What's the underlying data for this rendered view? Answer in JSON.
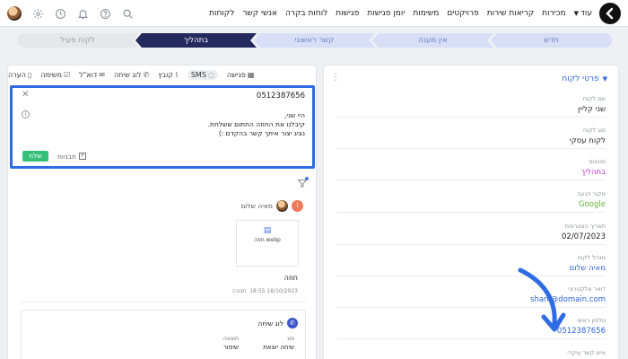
{
  "nav": {
    "items": [
      "לקוחות",
      "אנשי קשר",
      "לוחות בקרה",
      "פגישות",
      "יומן פגישות",
      "משימות",
      "פרויקטים",
      "קריאות שירות",
      "מכירות",
      "עוד"
    ]
  },
  "pipeline": {
    "stages": [
      "חדש",
      "אין מענה",
      "קשר ראשוני",
      "בתהליך",
      "לקוח פעיל"
    ],
    "active_index": 3
  },
  "details": {
    "title": "פרטי לקוח",
    "fields": [
      {
        "label": "שם לקוח",
        "value": "שני קליין",
        "style": ""
      },
      {
        "label": "סוג לקוח",
        "value": "לקוח עסקי",
        "style": ""
      },
      {
        "label": "סטטוס",
        "value": "בתהליך",
        "style": "purple"
      },
      {
        "label": "מקור הגעה",
        "value": "Google",
        "style": "green"
      },
      {
        "label": "תאריך הצטרפות",
        "value": "02/07/2023",
        "style": ""
      },
      {
        "label": "מנהל לקוח",
        "value": "מאיה שלום",
        "style": "blue"
      },
      {
        "label": "דואר אלקטרוני",
        "value": "shani@domain.com",
        "style": "blue"
      },
      {
        "label": "טלפון ראשי",
        "value": "0512387656",
        "style": "blue"
      },
      {
        "label": "איש קשר עיקרי",
        "value": "",
        "style": ""
      }
    ]
  },
  "activity": {
    "tabs": [
      {
        "label": "הערה",
        "icon": "note-icon"
      },
      {
        "label": "משימה",
        "icon": "task-icon"
      },
      {
        "label": "דוא\"ל",
        "icon": "mail-icon"
      },
      {
        "label": "לוג שיחה",
        "icon": "phone-icon"
      },
      {
        "label": "קובץ",
        "icon": "paperclip-icon"
      },
      {
        "label": "SMS",
        "icon": "chat-icon"
      },
      {
        "label": "פגישה",
        "icon": "calendar-icon"
      }
    ],
    "active_tab": "SMS",
    "composer": {
      "phone": "0512387656",
      "message_lines": [
        "היי שני,",
        "קיבלנו את החוזה החתום ששלחת.",
        "נציג יצור איתך קשר בהקדם :)"
      ],
      "send_label": "שלח",
      "templates_label": "תבניות"
    },
    "entry": {
      "author": "מאיה שלום",
      "file_name": "חוזה.webp",
      "title": "חוזה",
      "date": "18/10/2023 18:55",
      "reply": "תגובה"
    },
    "call": {
      "title": "לוג שיחה",
      "type_label": "סוג",
      "type_value": "שיחה יוצאת",
      "result_label": "תוצאה",
      "result_value": "שימור"
    }
  },
  "colors": {
    "accent": "#2f6be3",
    "active_stage": "#24295e",
    "send_green": "#35c07a"
  }
}
